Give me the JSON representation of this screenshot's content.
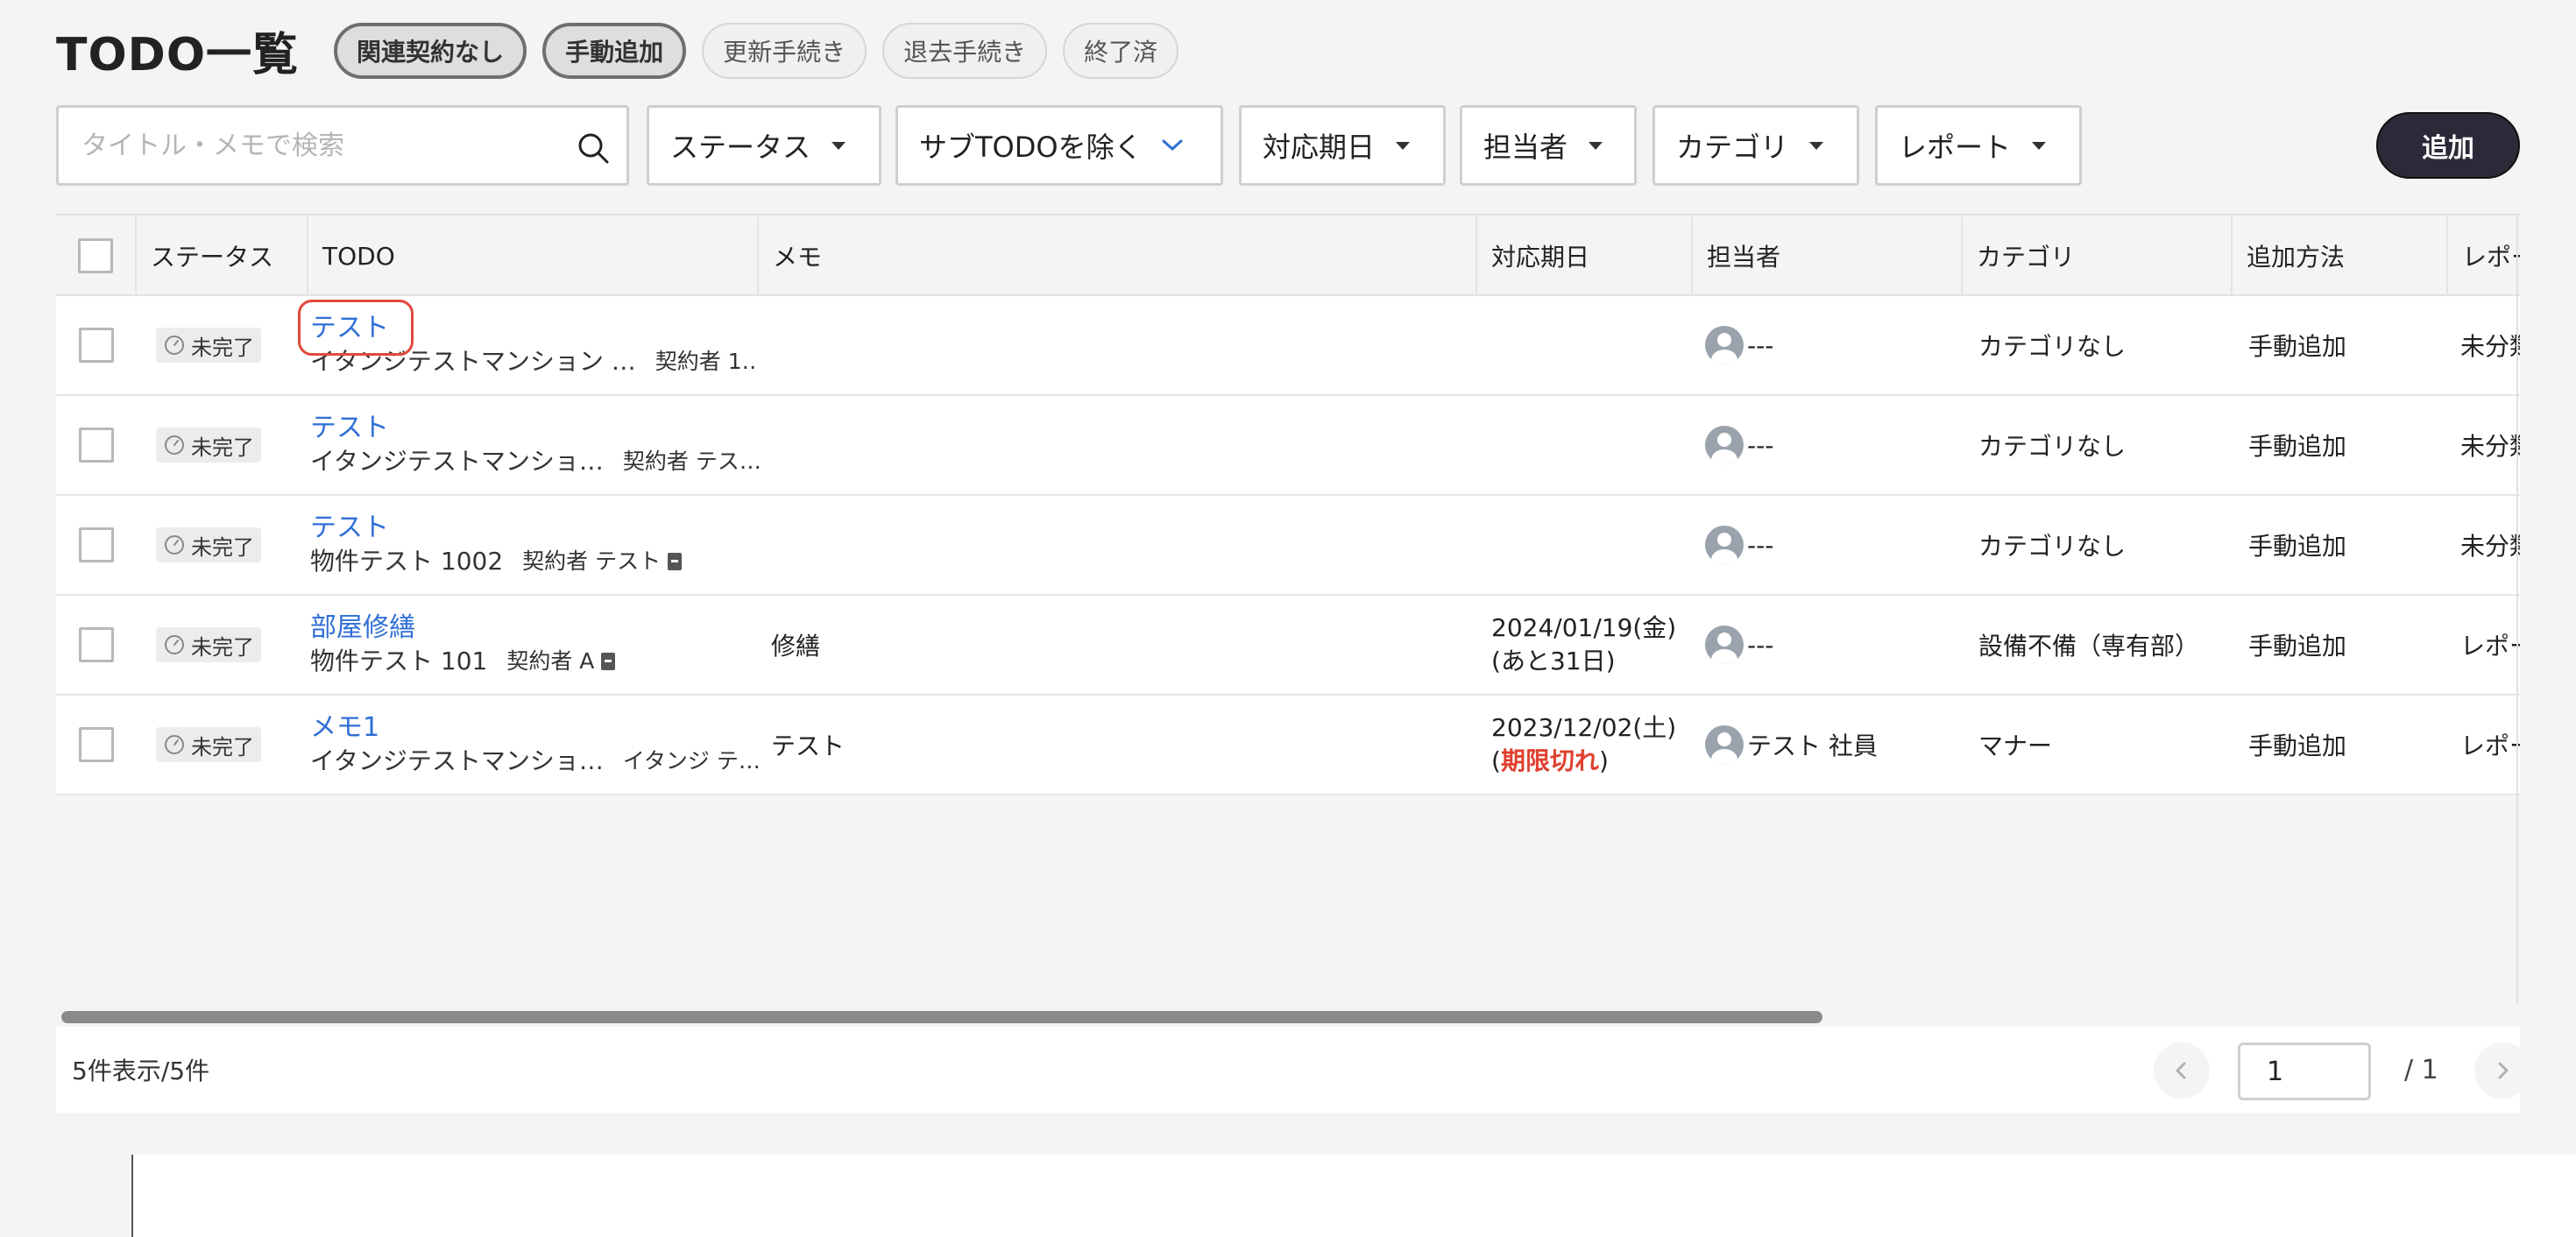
{
  "header": {
    "title": "TODO一覧",
    "chips": [
      {
        "label": "関連契約なし",
        "active": true
      },
      {
        "label": "手動追加",
        "active": true
      },
      {
        "label": "更新手続き",
        "active": false
      },
      {
        "label": "退去手続き",
        "active": false
      },
      {
        "label": "終了済",
        "active": false
      }
    ]
  },
  "filters": {
    "search_placeholder": "タイトル・メモで検索",
    "status": "ステータス",
    "subtodo": "サブTODOを除く",
    "due": "対応期日",
    "assignee": "担当者",
    "category": "カテゴリ",
    "report": "レポート",
    "add_label": "追加"
  },
  "table": {
    "columns": [
      "ステータス",
      "TODO",
      "メモ",
      "対応期日",
      "担当者",
      "カテゴリ",
      "追加方法",
      "レポー"
    ],
    "rows": [
      {
        "status": "未完了",
        "title": "テスト",
        "property": "イタンジテストマンション …",
        "contract": "契約者 1…",
        "contract_icon": false,
        "memo": "",
        "due_date": "",
        "due_note": "",
        "due_overdue": false,
        "assignee": "---",
        "category": "カテゴリなし",
        "method": "手動追加",
        "report": "未分類"
      },
      {
        "status": "未完了",
        "title": "テスト",
        "property": "イタンジテストマンショ…",
        "contract": "契約者 テス…",
        "contract_icon": false,
        "memo": "",
        "due_date": "",
        "due_note": "",
        "due_overdue": false,
        "assignee": "---",
        "category": "カテゴリなし",
        "method": "手動追加",
        "report": "未分類"
      },
      {
        "status": "未完了",
        "title": "テスト",
        "property": "物件テスト 1002",
        "contract": "契約者 テスト",
        "contract_icon": true,
        "memo": "",
        "due_date": "",
        "due_note": "",
        "due_overdue": false,
        "assignee": "---",
        "category": "カテゴリなし",
        "method": "手動追加",
        "report": "未分類"
      },
      {
        "status": "未完了",
        "title": "部屋修繕",
        "property": "物件テスト 101",
        "contract": "契約者 A",
        "contract_icon": true,
        "memo": "修繕",
        "due_date": "2024/01/19(金)",
        "due_note": "あと31日",
        "due_overdue": false,
        "assignee": "---",
        "category": "設備不備（専有部）",
        "method": "手動追加",
        "report": "レポー"
      },
      {
        "status": "未完了",
        "title": "メモ1",
        "property": "イタンジテストマンショ…",
        "contract": "イタンジ テ…",
        "contract_icon": false,
        "memo": "テスト",
        "due_date": "2023/12/02(土)",
        "due_note": "期限切れ",
        "due_overdue": true,
        "assignee": "テスト 社員",
        "category": "マナー",
        "method": "手動追加",
        "report": "レポー"
      }
    ]
  },
  "pagination": {
    "count_text": "5件表示/5件",
    "current_page": "1",
    "total_text": "/ 1"
  },
  "icons": [
    "search-icon",
    "caret-down-icon",
    "chevron-down-icon",
    "clock-icon",
    "avatar-icon",
    "document-icon",
    "chevron-left-icon",
    "chevron-right-icon"
  ],
  "colors": {
    "link": "#2f6fd6",
    "overdue": "#e0402f",
    "add_button": "#2a2a38",
    "highlight": "#e04a3a"
  }
}
